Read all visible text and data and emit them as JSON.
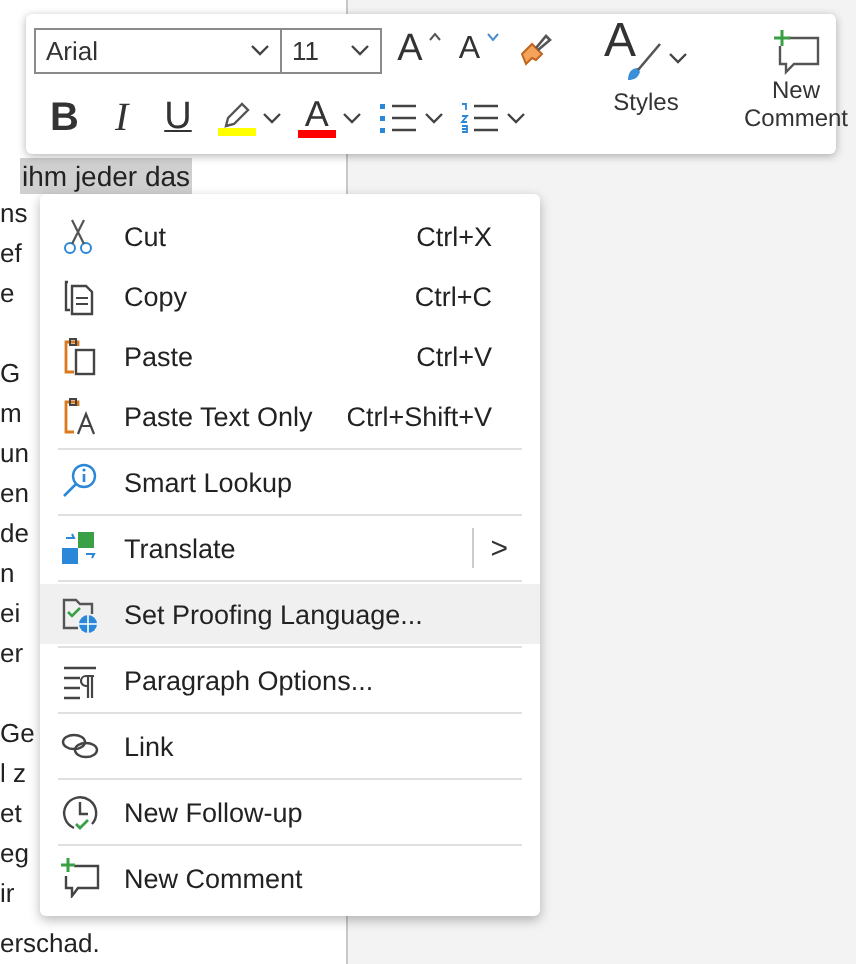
{
  "document": {
    "selected_line": "ihm jeder das",
    "paragraphs": [
      [
        "ns",
        "ef",
        "e"
      ],
      [
        "G",
        "m",
        "un",
        "en",
        "de",
        "n",
        "ei",
        "er"
      ],
      [
        "Ge",
        "l z",
        "et",
        "eg",
        "ir"
      ]
    ],
    "last_line": "erschad."
  },
  "toolbar": {
    "font": "Arial",
    "size": "11",
    "grow_font": "A",
    "shrink_font": "A",
    "format_buttons": [
      {
        "kind": "bold",
        "label": "B"
      },
      {
        "kind": "italic",
        "label": "I"
      },
      {
        "kind": "underline",
        "label": "U"
      },
      {
        "kind": "highlight",
        "color": "#ffff00"
      },
      {
        "kind": "font-color",
        "label": "A",
        "color": "#ff0000"
      },
      {
        "kind": "bullets"
      },
      {
        "kind": "numbering"
      }
    ],
    "styles": {
      "icon_letter": "A",
      "label": "Styles"
    },
    "new_comment": {
      "label": "New Comment"
    }
  },
  "context_menu": [
    {
      "kind": "cut",
      "label": "Cut",
      "shortcut": "Ctrl+X",
      "selected": false,
      "divider_before": false,
      "submenu": false
    },
    {
      "kind": "copy",
      "label": "Copy",
      "shortcut": "Ctrl+C",
      "selected": false,
      "divider_before": false,
      "submenu": false
    },
    {
      "kind": "paste",
      "label": "Paste",
      "shortcut": "Ctrl+V",
      "selected": false,
      "divider_before": false,
      "submenu": false
    },
    {
      "kind": "paste-text",
      "label": "Paste Text Only",
      "shortcut": "Ctrl+Shift+V",
      "selected": false,
      "divider_before": false,
      "submenu": false
    },
    {
      "kind": "lookup",
      "label": "Smart Lookup",
      "selected": false,
      "divider_before": true,
      "submenu": false
    },
    {
      "kind": "translate",
      "label": "Translate",
      "selected": false,
      "divider_before": true,
      "submenu": true,
      "arrow": ">"
    },
    {
      "kind": "proofing",
      "label": "Set Proofing Language...",
      "selected": true,
      "divider_before": true,
      "submenu": false
    },
    {
      "kind": "paragraph",
      "label": "Paragraph Options...",
      "selected": false,
      "divider_before": true,
      "submenu": false
    },
    {
      "kind": "link",
      "label": "Link",
      "selected": false,
      "divider_before": true,
      "submenu": false
    },
    {
      "kind": "follow-up",
      "label": "New Follow-up",
      "selected": false,
      "divider_before": true,
      "submenu": false
    },
    {
      "kind": "comment",
      "label": "New Comment",
      "selected": false,
      "divider_before": true,
      "submenu": false
    }
  ]
}
